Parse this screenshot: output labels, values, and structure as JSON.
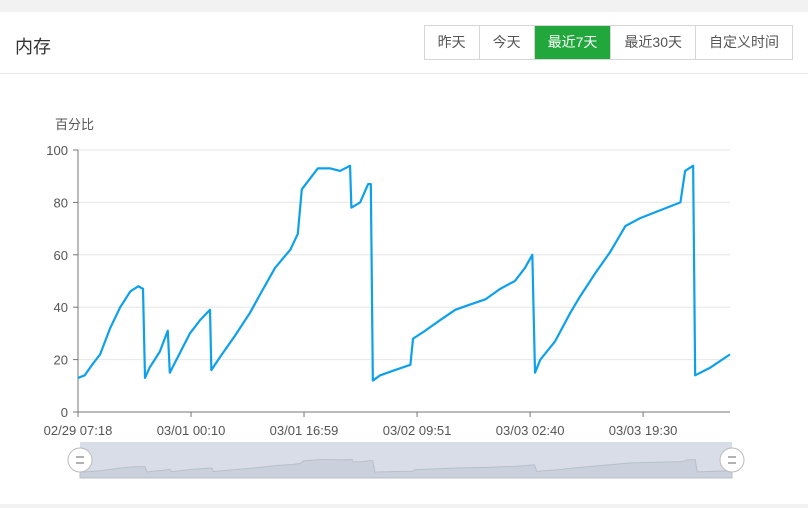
{
  "header": {
    "title": "内存",
    "buttons": [
      {
        "label": "昨天",
        "active": false
      },
      {
        "label": "今天",
        "active": false
      },
      {
        "label": "最近7天",
        "active": true
      },
      {
        "label": "最近30天",
        "active": false
      },
      {
        "label": "自定义时间",
        "active": false
      }
    ]
  },
  "colors": {
    "accent": "#21a73c",
    "line": "#0ea0ea"
  },
  "chart_data": {
    "type": "line",
    "ylabel": "百分比",
    "ylim": [
      0,
      100
    ],
    "yticks": [
      0,
      20,
      40,
      60,
      80,
      100
    ],
    "xunit": "hours since 02/29 07:18",
    "xlim": [
      0,
      97.3
    ],
    "xticks": [
      {
        "x": 0,
        "label": "02/29 07:18"
      },
      {
        "x": 16.87,
        "label": "03/01 00:10"
      },
      {
        "x": 33.73,
        "label": "03/01 16:59"
      },
      {
        "x": 50.6,
        "label": "03/02 09:51"
      },
      {
        "x": 67.47,
        "label": "03/03 02:40"
      },
      {
        "x": 84.33,
        "label": "03/03 19:30"
      }
    ],
    "series": [
      {
        "name": "内存",
        "points": [
          [
            0,
            13
          ],
          [
            1,
            14
          ],
          [
            2.1,
            18
          ],
          [
            3.3,
            22
          ],
          [
            4.8,
            32
          ],
          [
            6.3,
            40
          ],
          [
            7.8,
            46
          ],
          [
            9,
            48
          ],
          [
            9.7,
            47
          ],
          [
            10,
            13
          ],
          [
            10.7,
            17
          ],
          [
            12.2,
            23
          ],
          [
            13.4,
            31
          ],
          [
            13.7,
            15
          ],
          [
            14.9,
            21
          ],
          [
            16.7,
            30
          ],
          [
            18.2,
            35
          ],
          [
            19.7,
            39
          ],
          [
            19.9,
            16
          ],
          [
            21.2,
            21
          ],
          [
            23.4,
            29
          ],
          [
            25.7,
            38
          ],
          [
            27.2,
            45
          ],
          [
            29.4,
            55
          ],
          [
            31.7,
            62
          ],
          [
            32.8,
            68
          ],
          [
            33.4,
            85
          ],
          [
            34.6,
            89
          ],
          [
            35.8,
            93
          ],
          [
            37.6,
            93
          ],
          [
            39.1,
            92
          ],
          [
            40.6,
            94
          ],
          [
            40.8,
            78
          ],
          [
            42.1,
            80
          ],
          [
            43.3,
            87
          ],
          [
            43.7,
            87
          ],
          [
            44,
            12
          ],
          [
            45.1,
            14
          ],
          [
            47.3,
            16
          ],
          [
            49.6,
            18
          ],
          [
            50,
            28
          ],
          [
            51.8,
            31
          ],
          [
            54,
            35
          ],
          [
            56.3,
            39
          ],
          [
            58.5,
            41
          ],
          [
            60.8,
            43
          ],
          [
            63,
            47
          ],
          [
            65.2,
            50
          ],
          [
            66.7,
            55
          ],
          [
            67.8,
            60
          ],
          [
            68.2,
            15
          ],
          [
            69,
            20
          ],
          [
            71.2,
            27
          ],
          [
            73.5,
            38
          ],
          [
            74.9,
            44
          ],
          [
            77.2,
            53
          ],
          [
            79.4,
            61
          ],
          [
            81.7,
            71
          ],
          [
            83.9,
            74
          ],
          [
            86.9,
            77
          ],
          [
            89.9,
            80
          ],
          [
            90.6,
            92
          ],
          [
            91.8,
            94
          ],
          [
            92.1,
            14
          ],
          [
            94.4,
            17
          ],
          [
            97.3,
            22
          ]
        ]
      }
    ],
    "zoom_range": [
      0,
      100
    ]
  }
}
